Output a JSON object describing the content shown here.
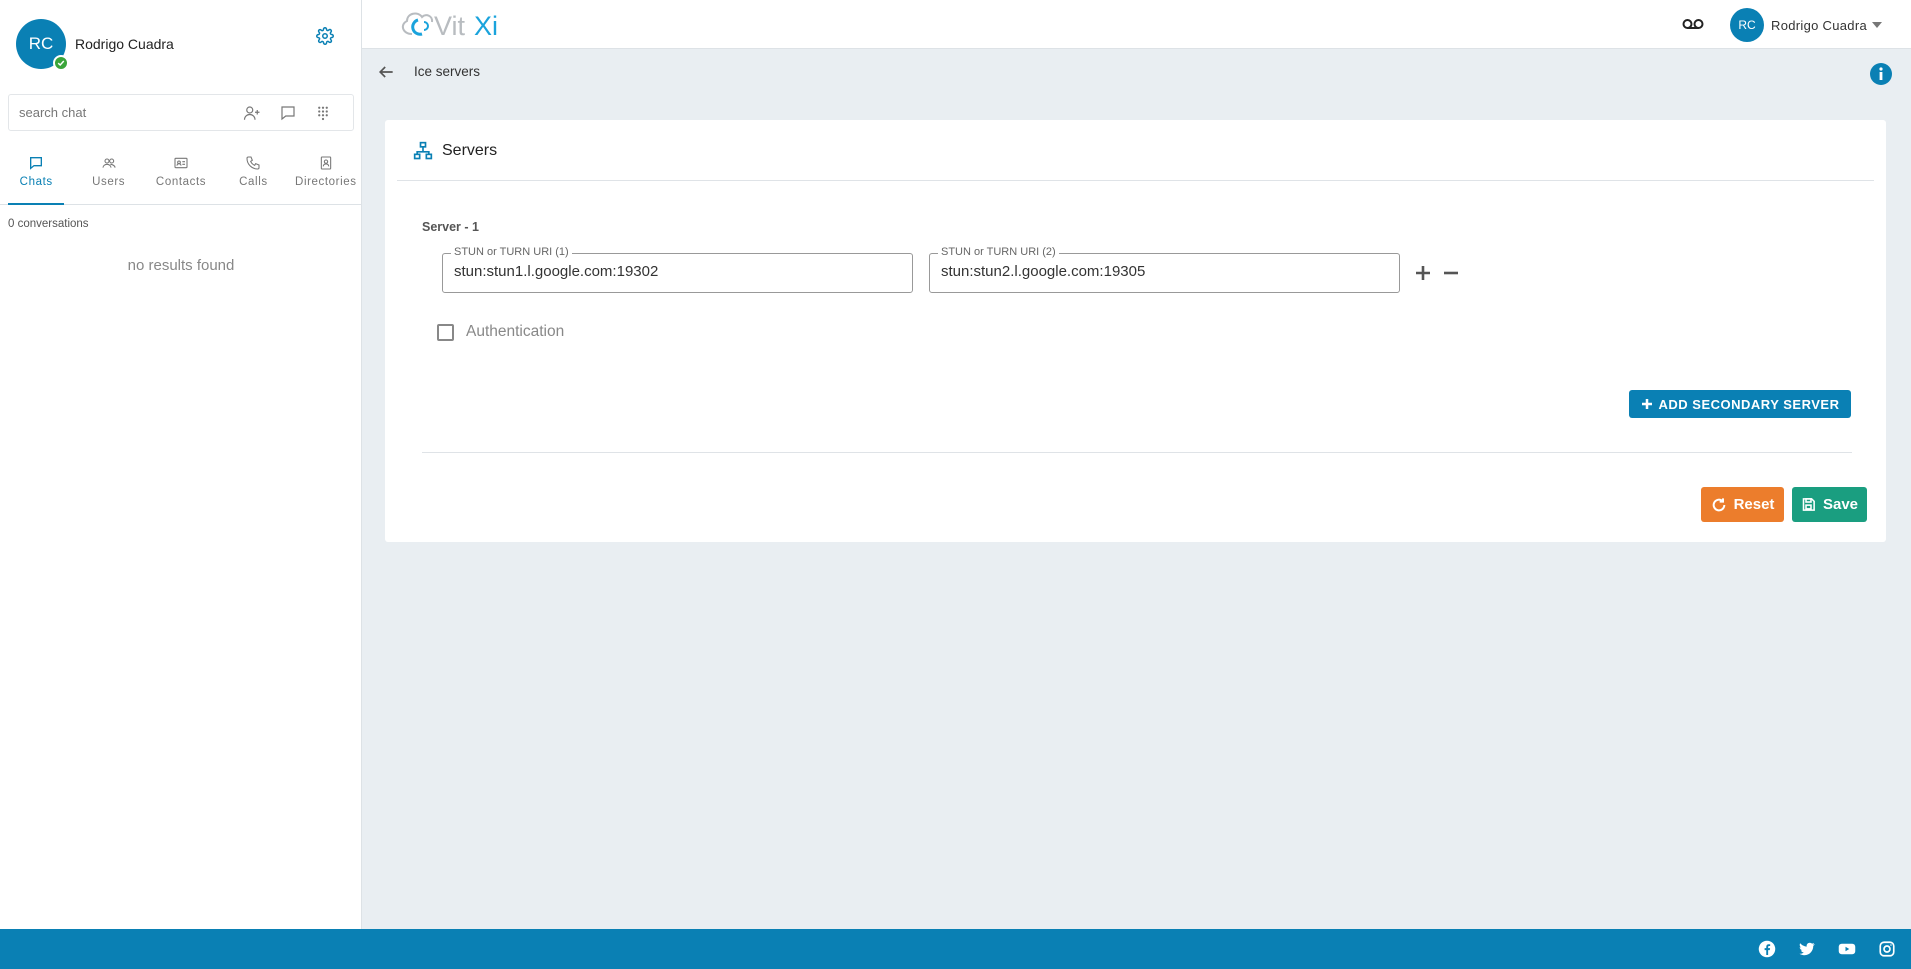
{
  "user": {
    "initials": "RC",
    "name": "Rodrigo Cuadra"
  },
  "search": {
    "placeholder": "search chat"
  },
  "tabs": [
    {
      "label": "Chats",
      "icon": "chat-icon",
      "active": true
    },
    {
      "label": "Users",
      "icon": "users-icon",
      "active": false
    },
    {
      "label": "Contacts",
      "icon": "contacts-icon",
      "active": false
    },
    {
      "label": "Calls",
      "icon": "phone-icon",
      "active": false
    },
    {
      "label": "Directories",
      "icon": "directory-icon",
      "active": false
    }
  ],
  "conversations": {
    "count_label": "0 conversations",
    "empty_label": "no results found"
  },
  "page": {
    "title": "Ice servers"
  },
  "card": {
    "title": "Servers",
    "server_label": "Server - 1",
    "fields": [
      {
        "label": "STUN or TURN URI (1)",
        "value": "stun:stun1.l.google.com:19302"
      },
      {
        "label": "STUN or TURN URI (2)",
        "value": "stun:stun2.l.google.com:19305"
      }
    ],
    "auth_label": "Authentication",
    "auth_checked": false,
    "add_secondary_label": "ADD SECONDARY SERVER",
    "reset_label": "Reset",
    "save_label": "Save"
  },
  "colors": {
    "primary": "#0a80b4",
    "reset": "#ec7d2c",
    "save": "#1a9e80",
    "status": "#3aa53a"
  }
}
